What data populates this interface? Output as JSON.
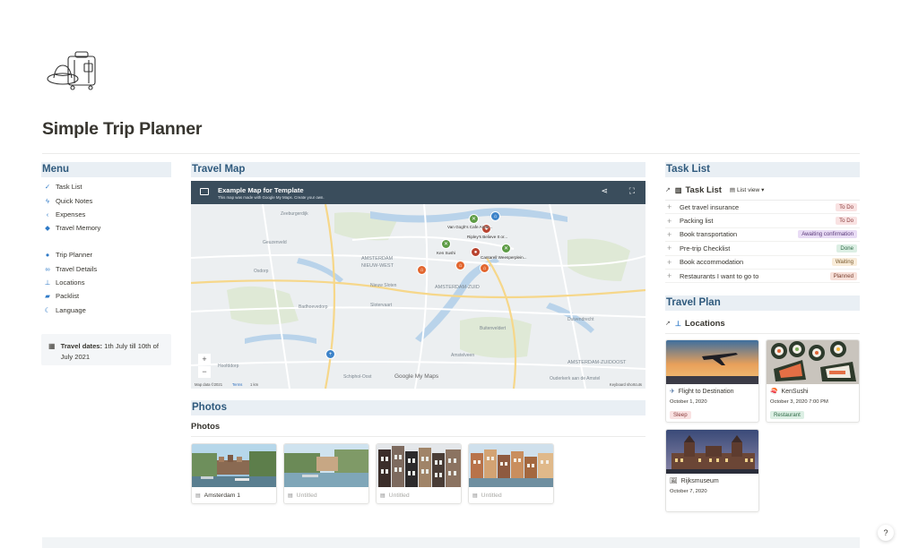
{
  "page": {
    "title": "Simple Trip Planner",
    "cover_icon": "travel-luggage-icon"
  },
  "menu": {
    "heading": "Menu",
    "group1": [
      {
        "label": "Task List",
        "icon": "checkbox-icon"
      },
      {
        "label": "Quick Notes",
        "icon": "lightning-icon"
      },
      {
        "label": "Expenses",
        "icon": "chevron-left-icon"
      },
      {
        "label": "Travel Memory",
        "icon": "layers-icon"
      }
    ],
    "group2": [
      {
        "label": "Trip Planner",
        "icon": "lightbulb-icon"
      },
      {
        "label": "Travel Details",
        "icon": "link-icon"
      },
      {
        "label": "Locations",
        "icon": "pin-icon"
      },
      {
        "label": "Packlist",
        "icon": "tag-icon"
      },
      {
        "label": "Language",
        "icon": "moon-icon"
      }
    ],
    "callout": {
      "icon": "calendar-icon",
      "label": "Travel dates:",
      "text": " 1th July till 10th of July 2021"
    }
  },
  "map": {
    "heading": "Travel Map",
    "title": "Example Map for Template",
    "subtitle": "This map was made with Google My Maps. Create your own.",
    "district_labels": [
      "Zeeburgerdijk",
      "AMSTERDAM NIEUW-WEST",
      "AMSTERDAM-ZUID",
      "Osdorp",
      "Slotervaart",
      "Buitenveldert",
      "Amstelveen",
      "Hoofddorp",
      "AMSTERDAM-ZUIDOOST",
      "Duivendrecht",
      "Geuzenveld",
      "Badhoevedorp",
      "Nieuw Sloten",
      "Schiphol-Oost",
      "Ouderkerk aan de Amstel"
    ],
    "pin_labels": [
      "Van Gogh's Cafe Anne...",
      "Ripley's Believe It or...",
      "Ken Sushi",
      "Cantarell Weesperplein..."
    ],
    "footer": {
      "data": "Map data ©2021",
      "terms": "Terms",
      "scale": "1 km",
      "shortcuts": "Keyboard shortcuts"
    },
    "watermark": "Google My Maps",
    "zoom_in": "+",
    "zoom_out": "−"
  },
  "photos": {
    "heading": "Photos",
    "subheading": "Photos",
    "cards": [
      {
        "label": "Amsterdam 1",
        "muted": false
      },
      {
        "label": "Untitled",
        "muted": true
      },
      {
        "label": "Untitled",
        "muted": true
      },
      {
        "label": "Untitled",
        "muted": true
      }
    ]
  },
  "task_list": {
    "heading": "Task List",
    "db_title": "Task List",
    "view_label": "List view",
    "tasks": [
      {
        "name": "Get travel insurance",
        "status": "To Do",
        "bg": "#f9e2e2",
        "fg": "#8a3b3b"
      },
      {
        "name": "Packing list",
        "status": "To Do",
        "bg": "#f9e2e2",
        "fg": "#8a3b3b"
      },
      {
        "name": "Book transportation",
        "status": "Awaiting confirmation",
        "bg": "#e9dcf5",
        "fg": "#5a3a7a"
      },
      {
        "name": "Pre-trip Checklist",
        "status": "Done",
        "bg": "#dcefe4",
        "fg": "#2f6b47"
      },
      {
        "name": "Book accommodation",
        "status": "Waiting",
        "bg": "#f9ecd9",
        "fg": "#7a5a2e"
      },
      {
        "name": "Restaurants I want to go to",
        "status": "Planned",
        "bg": "#f7e0d9",
        "fg": "#7b4030"
      }
    ]
  },
  "travel_plan": {
    "heading": "Travel Plan",
    "db_title": "Locations",
    "cards": [
      {
        "name": "Flight to Destination",
        "icon": "airplane-icon",
        "date": "October 1, 2020",
        "tag": "Sleep",
        "tag_bg": "#f9e2e2",
        "tag_fg": "#8a3b3b"
      },
      {
        "name": "KenSushi",
        "icon": "sushi-icon",
        "date": "October 3, 2020 7:00 PM",
        "tag": "Restaurant",
        "tag_bg": "#dcefe4",
        "tag_fg": "#2f6b47"
      },
      {
        "name": "Rijksmuseum",
        "icon": "museum-icon",
        "date": "October 7, 2020",
        "tag": "",
        "tag_bg": "",
        "tag_fg": ""
      }
    ]
  },
  "help": {
    "label": "?"
  }
}
